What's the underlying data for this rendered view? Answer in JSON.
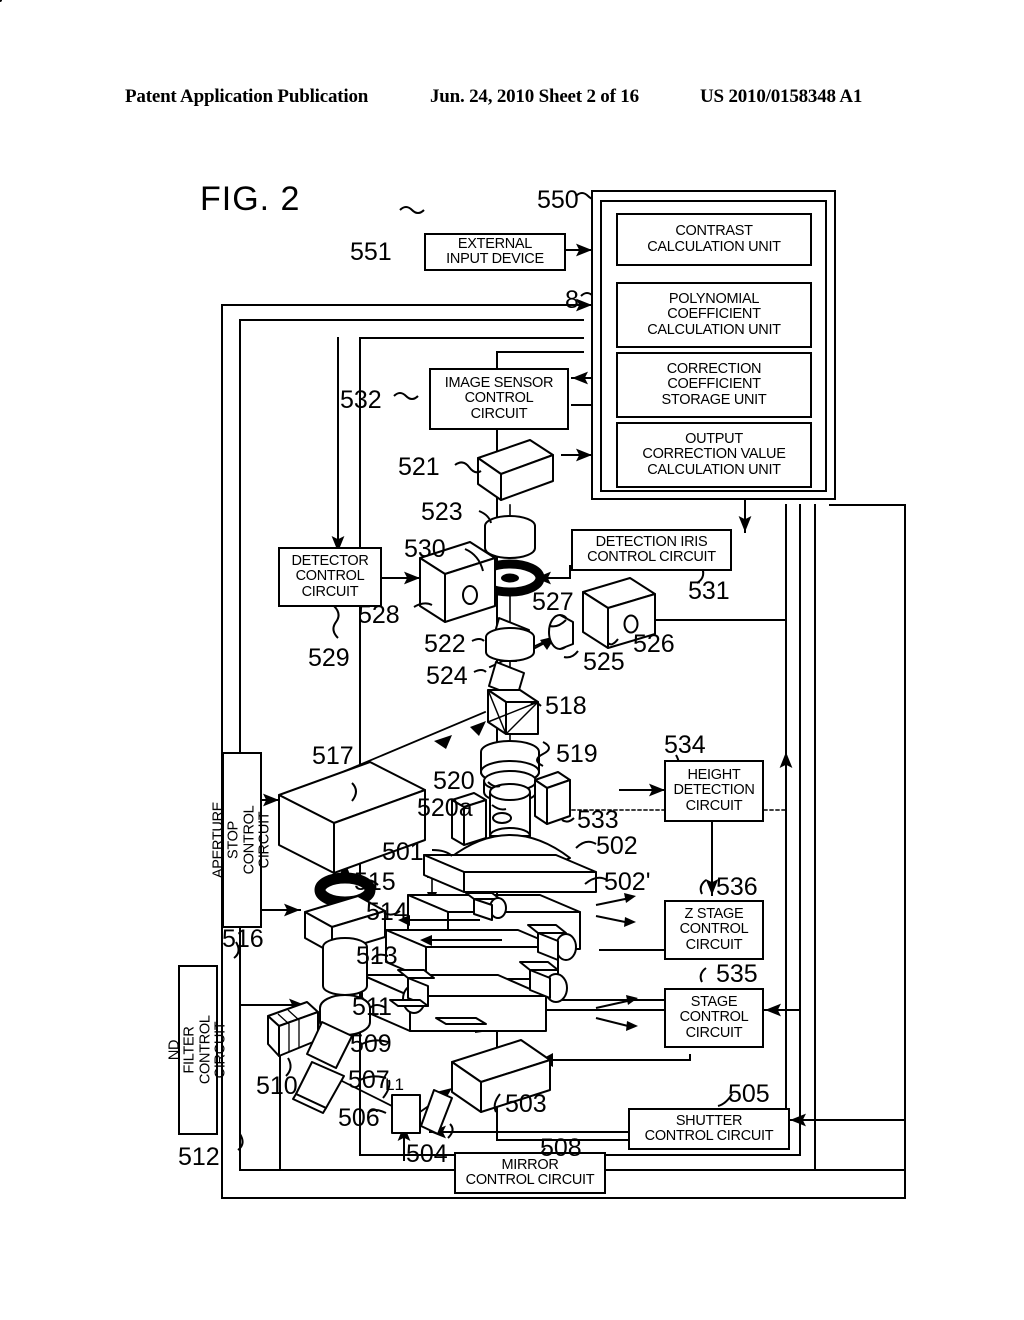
{
  "header": {
    "publication": "Patent Application Publication",
    "date_sheet": "Jun. 24, 2010  Sheet 2 of 16",
    "patent_number": "US 2010/0158348 A1"
  },
  "figure": {
    "title": "FIG. 2"
  },
  "blocks": {
    "external_input_device": "EXTERNAL\nINPUT DEVICE",
    "contrast_calculation_unit": "CONTRAST\nCALCULATION UNIT",
    "polynomial_coefficient_calculation_unit": "POLYNOMIAL\nCOEFFICIENT\nCALCULATION UNIT",
    "correction_coefficient_storage_unit": "CORRECTION\nCOEFFICIENT\nSTORAGE UNIT",
    "output_correction_value_calculation_unit": "OUTPUT\nCORRECTION VALUE\nCALCULATION UNIT",
    "image_sensor_control_circuit": "IMAGE SENSOR\nCONTROL\nCIRCUIT",
    "detector_control_circuit": "DETECTOR\nCONTROL\nCIRCUIT",
    "detection_iris_control_circuit": "DETECTION IRIS\nCONTROL CIRCUIT",
    "height_detection_circuit": "HEIGHT\nDETECTION\nCIRCUIT",
    "z_stage_control_circuit": "Z STAGE\nCONTROL\nCIRCUIT",
    "stage_control_circuit": "STAGE\nCONTROL\nCIRCUIT",
    "shutter_control_circuit": "SHUTTER\nCONTROL CIRCUIT",
    "mirror_control_circuit": "MIRROR\nCONTROL CIRCUIT",
    "aperture_stop_control_circuit": "APERTURE STOP\nCONTROL CIRCUIT",
    "nd_filter_control_circuit": "ND FILTER\nCONTROL CIRCUIT"
  },
  "numerals": {
    "n8": "8",
    "n550": "550",
    "n551": "551",
    "n532": "532",
    "n521": "521",
    "n523": "523",
    "n530": "530",
    "n528": "528",
    "n529": "529",
    "n531": "531",
    "n527": "527",
    "n526": "526",
    "n525": "525",
    "n522": "522",
    "n524": "524",
    "n518": "518",
    "n519": "519",
    "n520": "520",
    "n520a": "520a",
    "n533": "533",
    "n534": "534",
    "n536": "536",
    "n535": "535",
    "n517": "517",
    "n516": "516",
    "n515": "515",
    "n514": "514",
    "n513": "513",
    "n511": "511",
    "n512": "512",
    "n510": "510",
    "n509": "509",
    "n507": "507",
    "n506": "506",
    "n504": "504",
    "n503": "503",
    "n505": "505",
    "n508": "508",
    "n501": "501",
    "n502": "502",
    "n502p": "502'",
    "L1": "L1"
  },
  "colors": {
    "ink": "#000000",
    "paper": "#ffffff"
  }
}
